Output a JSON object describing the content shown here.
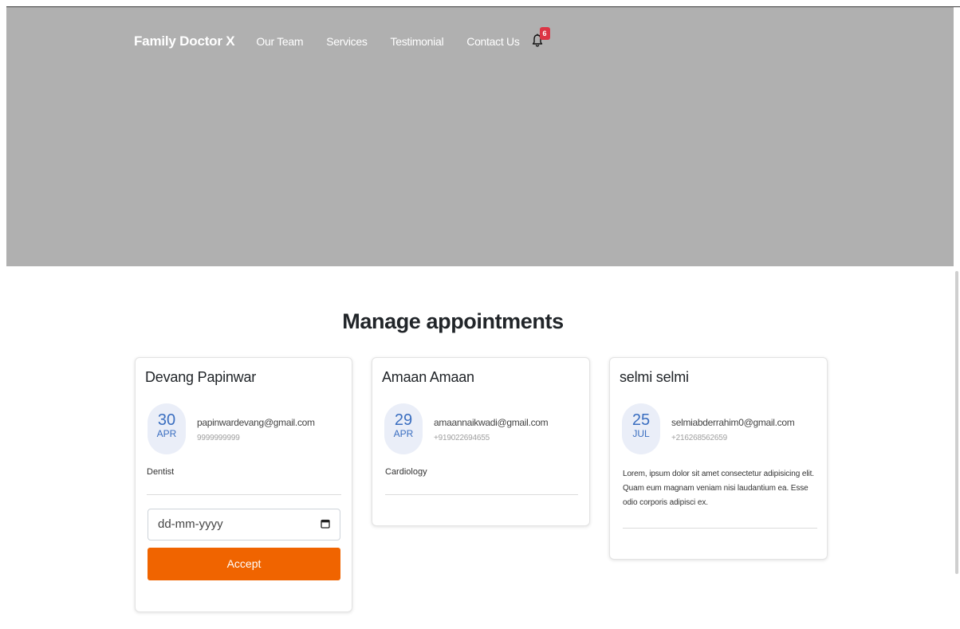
{
  "nav": {
    "brand": "Family Doctor X",
    "links": [
      "Our Team",
      "Services",
      "Testimonial",
      "Contact Us"
    ],
    "notifications_count": "6"
  },
  "main": {
    "title": "Manage appointments",
    "cards": [
      {
        "name": "Devang Papinwar",
        "day": "30",
        "month": "APR",
        "email": "papinwardevang@gmail.com",
        "phone": "9999999999",
        "note": "Dentist",
        "date_placeholder": "dd-mm-yyyy",
        "accept_label": "Accept"
      },
      {
        "name": "Amaan Amaan",
        "day": "29",
        "month": "APR",
        "email": "amaannaikwadi@gmail.com",
        "phone": "+919022694655",
        "note": "Cardiology"
      },
      {
        "name": "selmi selmi",
        "day": "25",
        "month": "JUL",
        "email": "selmiabderrahim0@gmail.com",
        "phone": "+216268562659",
        "note": "Lorem, ipsum dolor sit amet consectetur adipisicing elit. Quam eum magnam veniam nisi laudantium ea. Esse odio corporis adipisci ex."
      }
    ]
  },
  "colors": {
    "hero_bg": "#b0b0b0",
    "accent": "#f06400",
    "badge": "#dc3545",
    "date_text": "#3a6ec0"
  }
}
